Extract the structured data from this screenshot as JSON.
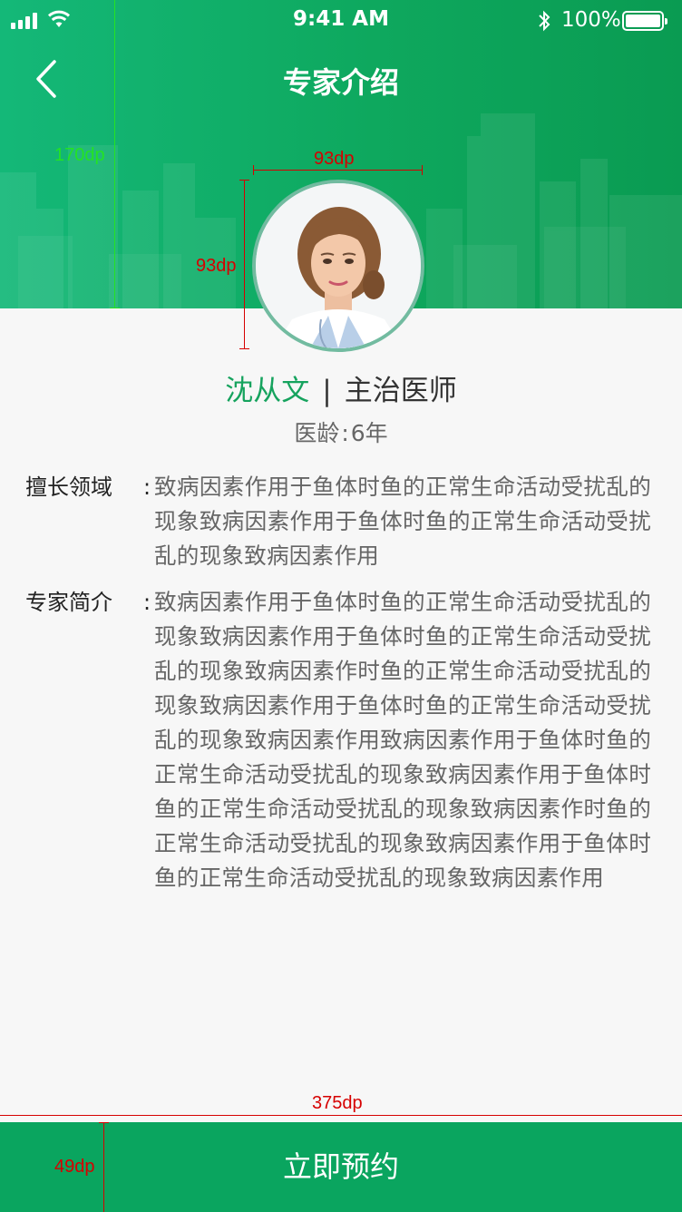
{
  "status_bar": {
    "time": "9:41 AM",
    "battery": "100%"
  },
  "header": {
    "title": "专家介绍"
  },
  "doctor": {
    "name": "沈从文",
    "separator": "|",
    "role": "主治医师",
    "experience_label": "医龄",
    "experience_colon": ":",
    "experience_value": "6年"
  },
  "specialty": {
    "label": "擅长领域",
    "colon": ":",
    "text": "致病因素作用于鱼体时鱼的正常生命活动受扰乱的现象致病因素作用于鱼体时鱼的正常生命活动受扰乱的现象致病因素作用"
  },
  "intro": {
    "label": "专家简介",
    "colon": ":",
    "text": "致病因素作用于鱼体时鱼的正常生命活动受扰乱的现象致病因素作用于鱼体时鱼的正常生命活动受扰乱的现象致病因素作时鱼的正常生命活动受扰乱的现象致病因素作用于鱼体时鱼的正常生命活动受扰乱的现象致病因素作用致病因素作用于鱼体时鱼的正常生命活动受扰乱的现象致病因素作用于鱼体时鱼的正常生命活动受扰乱的现象致病因素作时鱼的正常生命活动受扰乱的现象致病因素作用于鱼体时鱼的正常生命活动受扰乱的现象致病因素作用"
  },
  "action": {
    "book_label": "立即预约"
  },
  "annotations": {
    "header_height": "170dp",
    "avatar_width": "93dp",
    "avatar_height": "93dp",
    "screen_width": "375dp",
    "button_height": "49dp"
  },
  "colors": {
    "brand_green": "#0aa55f",
    "name_green": "#16a35e",
    "avatar_border": "#72bba0"
  }
}
